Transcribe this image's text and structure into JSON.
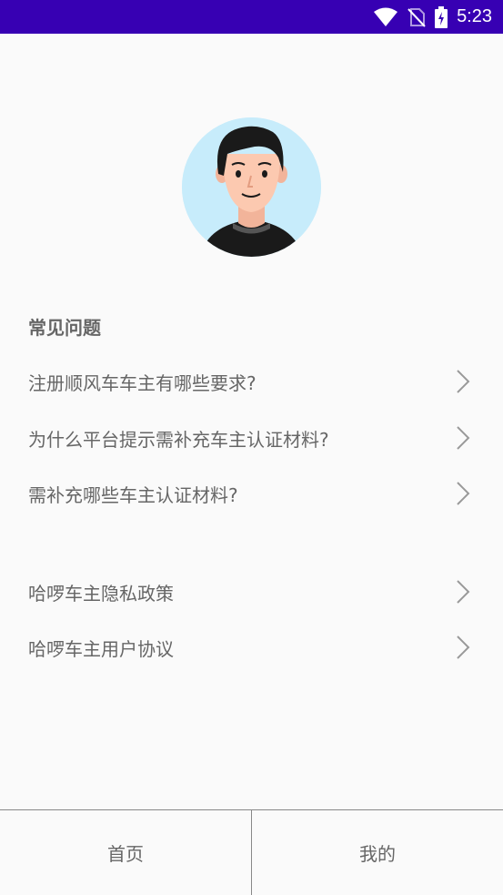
{
  "status_bar": {
    "time": "5:23",
    "bg_color": "#3700b3",
    "icons": [
      "wifi-icon",
      "no-sim-icon",
      "battery-charging-icon"
    ]
  },
  "profile": {
    "avatar_icon": "user-avatar-icon",
    "avatar_bg": "#c7ecfb"
  },
  "faq": {
    "title": "常见问题",
    "items": [
      {
        "label": "注册顺风车车主有哪些要求?"
      },
      {
        "label": "为什么平台提示需补充车主认证材料?"
      },
      {
        "label": "需补充哪些车主认证材料?"
      }
    ]
  },
  "legal": {
    "items": [
      {
        "label": "哈啰车主隐私政策"
      },
      {
        "label": "哈啰车主用户协议"
      }
    ]
  },
  "bottom_nav": {
    "tabs": [
      {
        "label": "首页"
      },
      {
        "label": "我的"
      }
    ]
  }
}
